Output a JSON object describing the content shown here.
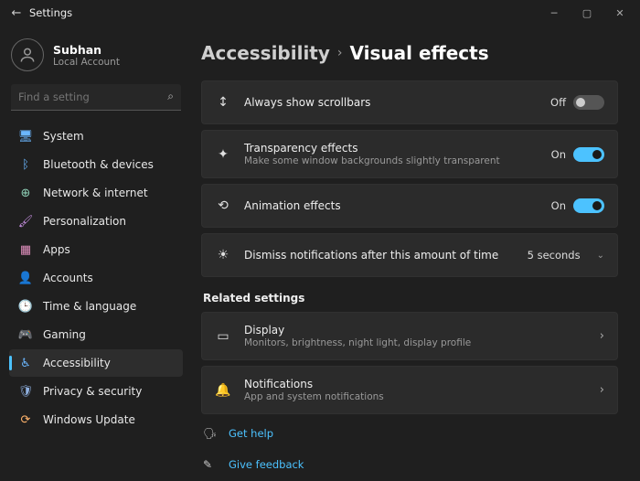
{
  "titlebar": {
    "app": "Settings"
  },
  "user": {
    "name": "Subhan",
    "account": "Local Account"
  },
  "search": {
    "placeholder": "Find a setting"
  },
  "nav": [
    {
      "label": "System",
      "icon": "system",
      "color": "#6bb7ff"
    },
    {
      "label": "Bluetooth & devices",
      "icon": "bt",
      "color": "#6bb7ff"
    },
    {
      "label": "Network & internet",
      "icon": "net",
      "color": "#8fd0b7"
    },
    {
      "label": "Personalization",
      "icon": "pers",
      "color": "#c58fe0"
    },
    {
      "label": "Apps",
      "icon": "apps",
      "color": "#e08fbd"
    },
    {
      "label": "Accounts",
      "icon": "acct",
      "color": "#8fd0e0"
    },
    {
      "label": "Time & language",
      "icon": "time",
      "color": "#8fe0c2"
    },
    {
      "label": "Gaming",
      "icon": "game",
      "color": "#a0e08f"
    },
    {
      "label": "Accessibility",
      "icon": "a11y",
      "color": "#6bb7ff",
      "active": true
    },
    {
      "label": "Privacy & security",
      "icon": "priv",
      "color": "#8fb0e0"
    },
    {
      "label": "Windows Update",
      "icon": "upd",
      "color": "#ffb36b"
    }
  ],
  "breadcrumb": {
    "parent": "Accessibility",
    "current": "Visual effects"
  },
  "cards": {
    "scrollbars": {
      "title": "Always show scrollbars",
      "state": "Off",
      "on": false
    },
    "transparency": {
      "title": "Transparency effects",
      "sub": "Make some window backgrounds slightly transparent",
      "state": "On",
      "on": true
    },
    "animation": {
      "title": "Animation effects",
      "state": "On",
      "on": true
    },
    "dismiss": {
      "title": "Dismiss notifications after this amount of time",
      "value": "5 seconds"
    }
  },
  "related": {
    "header": "Related settings",
    "display": {
      "title": "Display",
      "sub": "Monitors, brightness, night light, display profile"
    },
    "notif": {
      "title": "Notifications",
      "sub": "App and system notifications"
    }
  },
  "help": {
    "gethelp": "Get help",
    "feedback": "Give feedback"
  }
}
